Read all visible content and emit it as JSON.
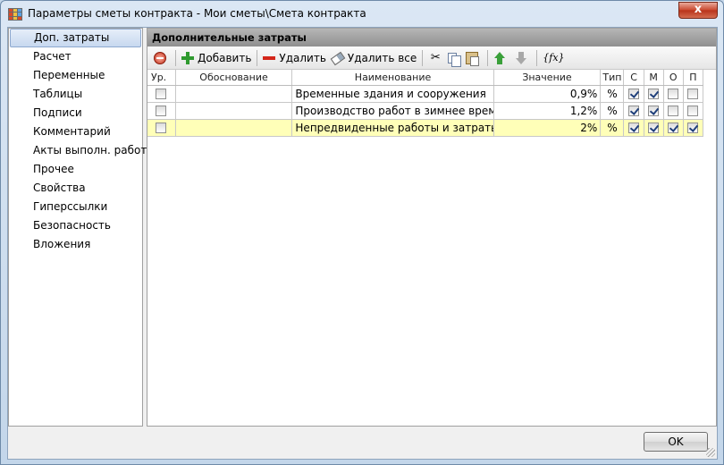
{
  "window": {
    "title": "Параметры сметы контракта - Мои сметы\\Смета контракта",
    "close_label": "x"
  },
  "sidebar": {
    "items": [
      {
        "label": "Доп. затраты",
        "selected": true
      },
      {
        "label": "Расчет"
      },
      {
        "label": "Переменные"
      },
      {
        "label": "Таблицы"
      },
      {
        "label": "Подписи"
      },
      {
        "label": "Комментарий"
      },
      {
        "label": "Акты выполн. работ"
      },
      {
        "label": "Прочее"
      },
      {
        "label": "Свойства"
      },
      {
        "label": "Гиперссылки"
      },
      {
        "label": "Безопасность"
      },
      {
        "label": "Вложения"
      }
    ]
  },
  "panel": {
    "header": "Дополнительные затраты"
  },
  "toolbar": {
    "add_label": "Добавить",
    "delete_label": "Удалить",
    "delete_all_label": "Удалить все",
    "fx_label": "{fx}"
  },
  "grid": {
    "columns": {
      "level": "Ур.",
      "basis": "Обоснование",
      "name": "Наименование",
      "value": "Значение",
      "type": "Тип",
      "c": "С",
      "m": "М",
      "o": "О",
      "p": "П"
    },
    "rows": [
      {
        "level": false,
        "basis": "",
        "name": "Временные здания и сооружения",
        "value": "0,9%",
        "type": "%",
        "c": true,
        "m": true,
        "o": false,
        "p": false,
        "selected": false
      },
      {
        "level": false,
        "basis": "",
        "name": "Производство работ в зимнее время",
        "value": "1,2%",
        "type": "%",
        "c": true,
        "m": true,
        "o": false,
        "p": false,
        "selected": false
      },
      {
        "level": false,
        "basis": "",
        "name": "Непредвиденные работы и затраты",
        "value": "2%",
        "type": "%",
        "c": true,
        "m": true,
        "o": true,
        "p": true,
        "selected": true
      }
    ]
  },
  "footer": {
    "ok_label": "OK"
  },
  "colors": {
    "selected_row": "#ffffb8",
    "header_bar": "#9a9a9a",
    "close_button": "#c9462c"
  }
}
